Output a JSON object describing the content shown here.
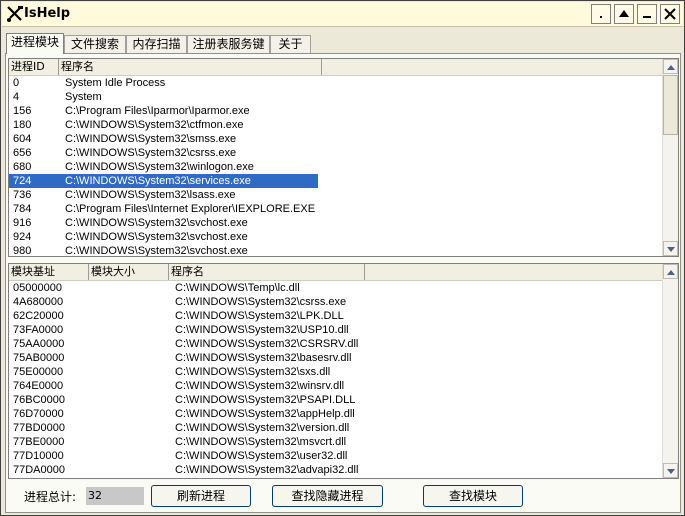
{
  "window": {
    "title": "IsHelp",
    "icon": "tools-icon"
  },
  "tabs": [
    {
      "label": "进程模块",
      "active": true
    },
    {
      "label": "文件搜索",
      "active": false
    },
    {
      "label": "内存扫描",
      "active": false
    },
    {
      "label": "注册表服务键",
      "active": false
    },
    {
      "label": "关于",
      "active": false
    }
  ],
  "process_list": {
    "columns": [
      "进程ID",
      "程序名"
    ],
    "selected_index": 7,
    "rows": [
      {
        "pid": "0",
        "name": "System Idle Process"
      },
      {
        "pid": "4",
        "name": "System"
      },
      {
        "pid": "156",
        "name": "C:\\Program Files\\Iparmor\\Iparmor.exe"
      },
      {
        "pid": "180",
        "name": "C:\\WINDOWS\\System32\\ctfmon.exe"
      },
      {
        "pid": "604",
        "name": "C:\\WINDOWS\\System32\\smss.exe"
      },
      {
        "pid": "656",
        "name": "C:\\WINDOWS\\System32\\csrss.exe"
      },
      {
        "pid": "680",
        "name": "C:\\WINDOWS\\System32\\winlogon.exe"
      },
      {
        "pid": "724",
        "name": "C:\\WINDOWS\\System32\\services.exe"
      },
      {
        "pid": "736",
        "name": "C:\\WINDOWS\\System32\\lsass.exe"
      },
      {
        "pid": "784",
        "name": "C:\\Program Files\\Internet Explorer\\IEXPLORE.EXE"
      },
      {
        "pid": "916",
        "name": "C:\\WINDOWS\\System32\\svchost.exe"
      },
      {
        "pid": "924",
        "name": "C:\\WINDOWS\\System32\\svchost.exe"
      },
      {
        "pid": "980",
        "name": "C:\\WINDOWS\\System32\\svchost.exe"
      }
    ]
  },
  "module_list": {
    "columns": [
      "模块基址",
      "模块大小",
      "程序名"
    ],
    "rows": [
      {
        "base": "05000000",
        "size": "",
        "name": "C:\\WINDOWS\\Temp\\lc.dll"
      },
      {
        "base": "4A680000",
        "size": "",
        "name": "C:\\WINDOWS\\System32\\csrss.exe"
      },
      {
        "base": "62C20000",
        "size": "",
        "name": "C:\\WINDOWS\\System32\\LPK.DLL"
      },
      {
        "base": "73FA0000",
        "size": "",
        "name": "C:\\WINDOWS\\System32\\USP10.dll"
      },
      {
        "base": "75AA0000",
        "size": "",
        "name": "C:\\WINDOWS\\System32\\CSRSRV.dll"
      },
      {
        "base": "75AB0000",
        "size": "",
        "name": "C:\\WINDOWS\\System32\\basesrv.dll"
      },
      {
        "base": "75E00000",
        "size": "",
        "name": "C:\\WINDOWS\\System32\\sxs.dll"
      },
      {
        "base": "764E0000",
        "size": "",
        "name": "C:\\WINDOWS\\System32\\winsrv.dll"
      },
      {
        "base": "76BC0000",
        "size": "",
        "name": "C:\\WINDOWS\\System32\\PSAPI.DLL"
      },
      {
        "base": "76D70000",
        "size": "",
        "name": "C:\\WINDOWS\\System32\\appHelp.dll"
      },
      {
        "base": "77BD0000",
        "size": "",
        "name": "C:\\WINDOWS\\System32\\version.dll"
      },
      {
        "base": "77BE0000",
        "size": "",
        "name": "C:\\WINDOWS\\System32\\msvcrt.dll"
      },
      {
        "base": "77D10000",
        "size": "",
        "name": "C:\\WINDOWS\\System32\\user32.dll"
      },
      {
        "base": "77DA0000",
        "size": "",
        "name": "C:\\WINDOWS\\System32\\advapi32.dll"
      }
    ]
  },
  "status": {
    "label": "进程总计:",
    "count": "32"
  },
  "buttons": {
    "refresh": "刷新进程",
    "find_hidden": "查找隐藏进程",
    "find_module": "查找模块"
  },
  "colors": {
    "selection": "#316ac5",
    "title_bg": "#fffadb",
    "panel_bg": "#fbfbf6"
  }
}
